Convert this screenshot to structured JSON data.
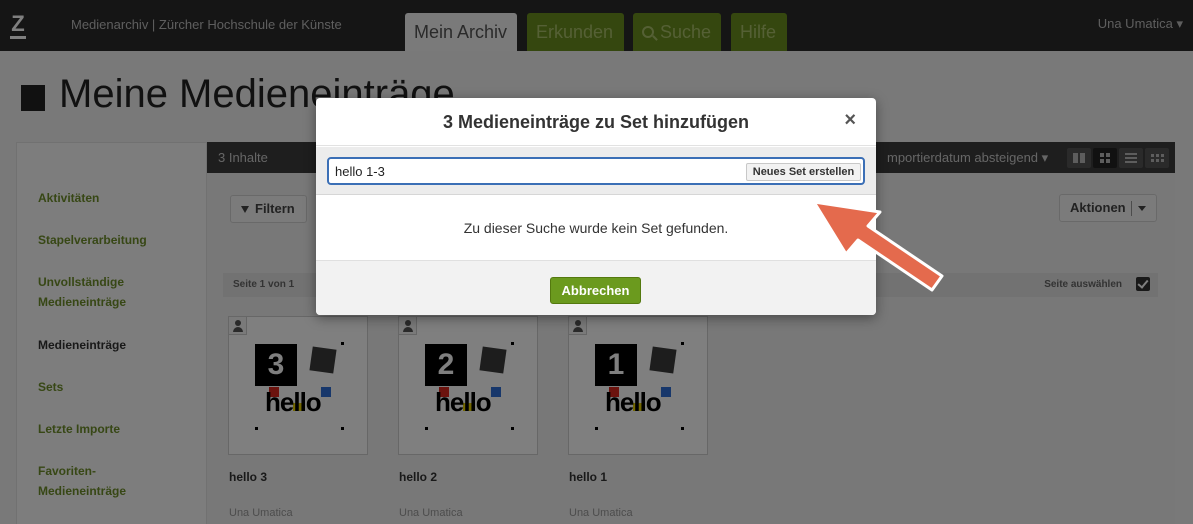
{
  "topbar": {
    "logo_letter": "Z",
    "app_title": "Medienarchiv | Zürcher Hochschule der Künste",
    "tabs": [
      {
        "label": "Mein Archiv"
      },
      {
        "label": "Erkunden"
      },
      {
        "label": "Suche",
        "icon": "search-icon"
      },
      {
        "label": "Hilfe"
      }
    ],
    "user": "Una Umatica ▾"
  },
  "page": {
    "title": "Meine Medieneinträge"
  },
  "sidebar": {
    "items": [
      {
        "label": "Aktivitäten"
      },
      {
        "label": "Stapelverarbeitung"
      },
      {
        "label": "Unvollständige"
      },
      {
        "label": "Medieneinträge"
      },
      {
        "label": "Medieneinträge"
      },
      {
        "label": "Sets"
      },
      {
        "label": "Letzte Importe"
      },
      {
        "label": "Favoriten-"
      },
      {
        "label": "Medieneinträge"
      }
    ]
  },
  "content": {
    "count": "3 Inhalte",
    "sort": "mportierdatum absteigend ▾",
    "filter_label": "Filtern",
    "actions_label": "Aktionen",
    "pager": "Seite 1 von 1",
    "select_page": "Seite auswählen",
    "entries": [
      {
        "num": "3",
        "word": "hello",
        "title": "hello 3",
        "author": "Una Umatica"
      },
      {
        "num": "2",
        "word": "hello",
        "title": "hello 2",
        "author": "Una Umatica"
      },
      {
        "num": "1",
        "word": "hello",
        "title": "hello 1",
        "author": "Una Umatica"
      }
    ]
  },
  "modal": {
    "title": "3 Medieneinträge zu Set hinzufügen",
    "close_glyph": "×",
    "search_value": "hello 1-3",
    "new_set_label": "Neues Set erstellen",
    "empty_message": "Zu dieser Suche wurde kein Set gefunden.",
    "cancel_label": "Abbrechen"
  },
  "colors": {
    "accent_green": "#6b9a1e",
    "input_focus": "#3b6fb6",
    "annotation_arrow": "#e46a4d"
  }
}
